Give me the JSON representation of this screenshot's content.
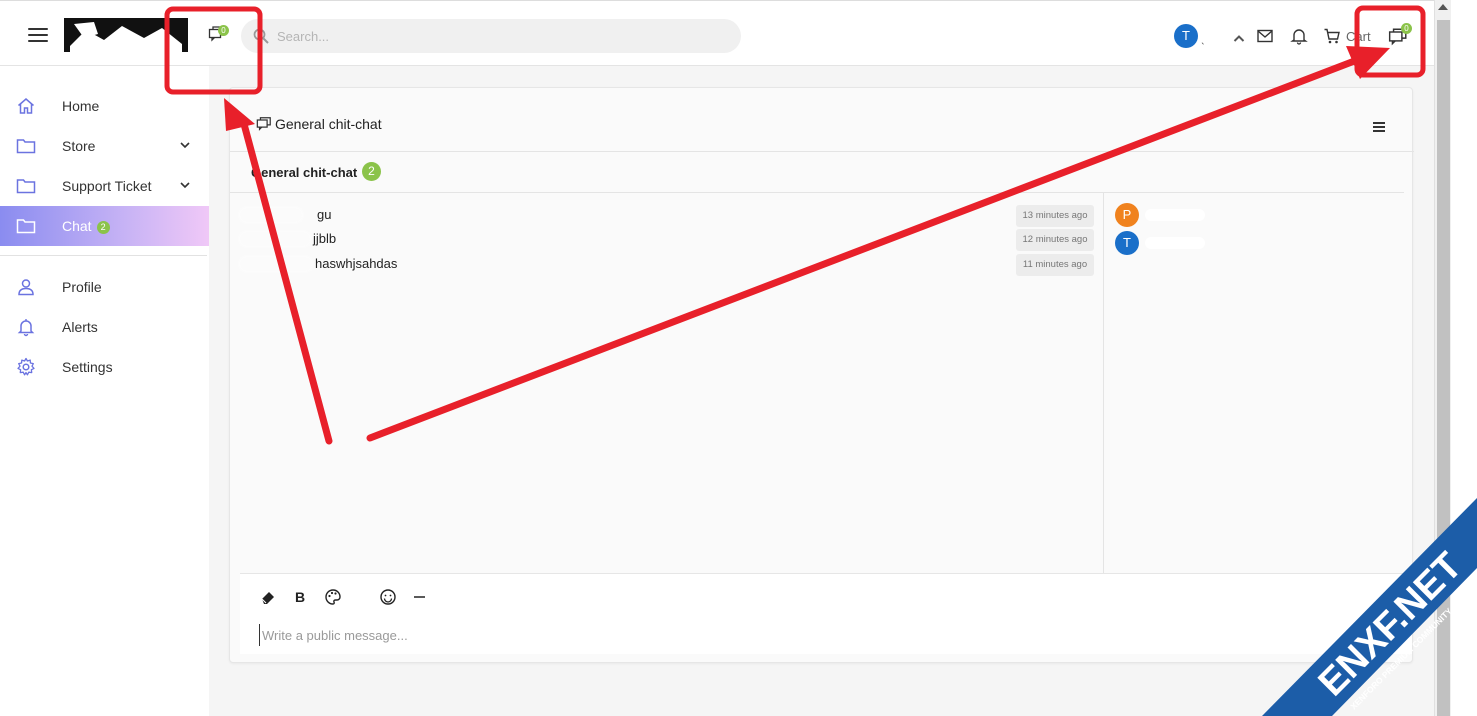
{
  "topbar": {
    "search_placeholder": "Search...",
    "user_initial": "T",
    "cart_label": "Cart",
    "chat_badge_left": "0",
    "chat_badge_right": "0"
  },
  "sidebar": {
    "items": [
      {
        "label": "Home",
        "icon": "home-icon"
      },
      {
        "label": "Store",
        "icon": "folder-icon"
      },
      {
        "label": "Support Ticket",
        "icon": "folder-icon"
      },
      {
        "label": "Chat",
        "icon": "folder-icon",
        "count": "2"
      },
      {
        "label": "Profile",
        "icon": "user-icon"
      },
      {
        "label": "Alerts",
        "icon": "bell-icon"
      },
      {
        "label": "Settings",
        "icon": "gear-icon"
      }
    ]
  },
  "chat": {
    "header_title": "General chit-chat",
    "room_name": "General chit-chat",
    "room_count": "2",
    "messages": [
      {
        "text": "gu",
        "time": "13 minutes ago"
      },
      {
        "text": "jjblb",
        "time": "12 minutes ago"
      },
      {
        "text": "haswhjsahdas",
        "time": "11 minutes ago"
      }
    ],
    "users": [
      {
        "initial": "P",
        "color": "#f0821e"
      },
      {
        "initial": "T",
        "color": "#1a6fc9"
      }
    ],
    "composer_placeholder": "Write a public message..."
  },
  "watermark": {
    "title": "ENXF.NET",
    "subtitle": "XENFORO PREMIUM COMMUNITY"
  },
  "colors": {
    "accent_badge": "#8bc34a",
    "annotation": "#e8202a",
    "active_nav_start": "#8a8cf0",
    "active_nav_end": "#f0c8f7",
    "watermark": "#1c5da8"
  }
}
